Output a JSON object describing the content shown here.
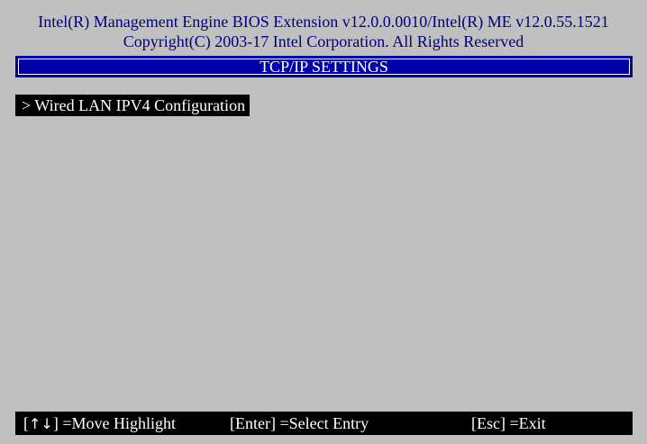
{
  "header": {
    "line1": "Intel(R) Management Engine BIOS Extension v12.0.0.0010/Intel(R) ME v12.0.55.1521",
    "line2": "Copyright(C) 2003-17 Intel Corporation. All Rights Reserved"
  },
  "title_bar": {
    "title": "TCP/IP SETTINGS"
  },
  "menu": {
    "items": [
      {
        "label": "> Wired LAN IPV4 Configuration",
        "selected": true
      }
    ]
  },
  "footer": {
    "hints": [
      {
        "key_open": "[",
        "key": "↑↓",
        "key_close": "]",
        "action": " =Move Highlight"
      },
      {
        "key_open": "",
        "key": "[Enter]",
        "key_close": "",
        "action": " =Select Entry"
      },
      {
        "key_open": "",
        "key": "[Esc]",
        "key_close": "",
        "action": " =Exit"
      }
    ]
  },
  "colors": {
    "background": "#c0c0c0",
    "header_text": "#000080",
    "title_bar": "#0000a8",
    "highlight_bg": "#000000",
    "highlight_text": "#ffffff"
  }
}
